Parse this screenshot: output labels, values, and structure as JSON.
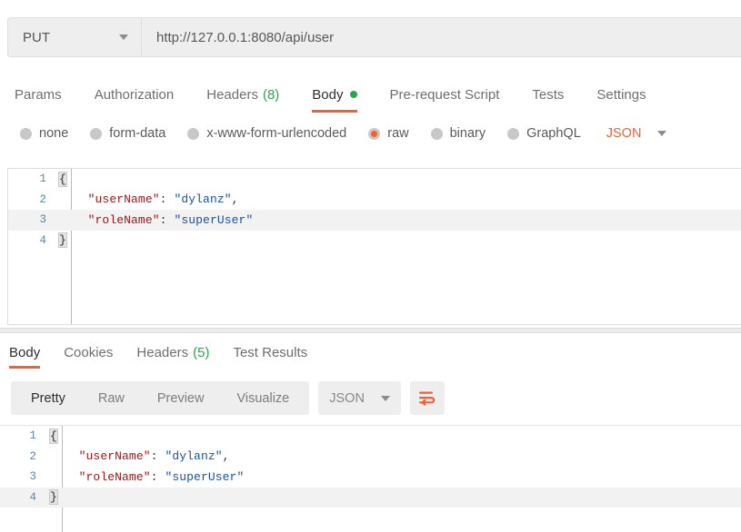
{
  "request": {
    "method": "PUT",
    "url": "http://127.0.0.1:8080/api/user",
    "tabs": [
      {
        "label": "Params",
        "active": false
      },
      {
        "label": "Authorization",
        "active": false
      },
      {
        "label": "Headers",
        "count": "(8)",
        "active": false
      },
      {
        "label": "Body",
        "active": true,
        "dot": true
      },
      {
        "label": "Pre-request Script",
        "active": false
      },
      {
        "label": "Tests",
        "active": false
      },
      {
        "label": "Settings",
        "active": false
      }
    ],
    "body_types": [
      {
        "label": "none",
        "selected": false
      },
      {
        "label": "form-data",
        "selected": false
      },
      {
        "label": "x-www-form-urlencoded",
        "selected": false
      },
      {
        "label": "raw",
        "selected": true
      },
      {
        "label": "binary",
        "selected": false
      },
      {
        "label": "GraphQL",
        "selected": false
      }
    ],
    "format_label": "JSON",
    "code": {
      "lines": [
        {
          "num": "1",
          "active": false
        },
        {
          "num": "2",
          "active": false
        },
        {
          "num": "3",
          "active": true
        },
        {
          "num": "4",
          "active": false
        }
      ],
      "l1_open": "{",
      "l2_key": "\"userName\"",
      "l2_sep": ": ",
      "l2_val": "\"dylanz\"",
      "l2_comma": ",",
      "l3_key": "\"roleName\"",
      "l3_sep": ": ",
      "l3_val": "\"superUser\"",
      "l4_close": "}",
      "indent": "    "
    }
  },
  "response": {
    "tabs": [
      {
        "label": "Body",
        "active": true
      },
      {
        "label": "Cookies",
        "active": false
      },
      {
        "label": "Headers",
        "count": "(5)",
        "active": false
      },
      {
        "label": "Test Results",
        "active": false
      }
    ],
    "views": [
      {
        "label": "Pretty",
        "active": true
      },
      {
        "label": "Raw",
        "active": false
      },
      {
        "label": "Preview",
        "active": false
      },
      {
        "label": "Visualize",
        "active": false
      }
    ],
    "format_label": "JSON",
    "code": {
      "lines": [
        {
          "num": "1",
          "active": false
        },
        {
          "num": "2",
          "active": false
        },
        {
          "num": "3",
          "active": false
        },
        {
          "num": "4",
          "active": true
        }
      ],
      "l1_open": "{",
      "l2_key": "\"userName\"",
      "l2_sep": ": ",
      "l2_val": "\"dylanz\"",
      "l2_comma": ",",
      "l3_key": "\"roleName\"",
      "l3_sep": ": ",
      "l3_val": "\"superUser\"",
      "l4_close": "}",
      "indent": "    "
    }
  },
  "colors": {
    "accent_orange": "#ef6033",
    "green": "#2ea34d",
    "json_key": "#a31515",
    "json_value": "#1a51a8",
    "gutter": "#5d87a8"
  }
}
